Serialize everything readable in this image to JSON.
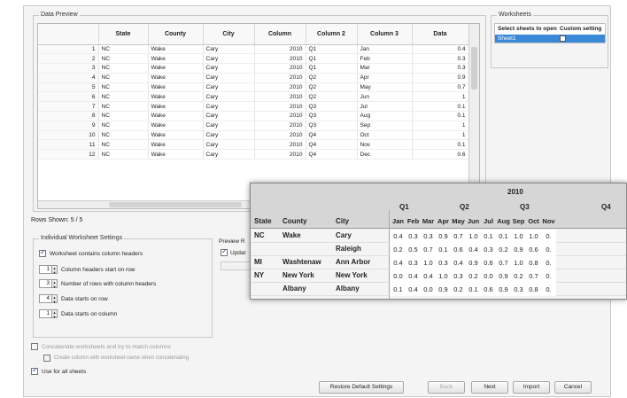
{
  "preview": {
    "title": "Data Preview",
    "columns": [
      "",
      "State",
      "County",
      "City",
      "Column",
      "Column 2",
      "Column 3",
      "Data"
    ],
    "rows": [
      [
        "1",
        "NC",
        "Wake",
        "Cary",
        "2010",
        "Q1",
        "Jan",
        "0.4"
      ],
      [
        "2",
        "NC",
        "Wake",
        "Cary",
        "2010",
        "Q1",
        "Feb",
        "0.3"
      ],
      [
        "3",
        "NC",
        "Wake",
        "Cary",
        "2010",
        "Q1",
        "Mar",
        "0.3"
      ],
      [
        "4",
        "NC",
        "Wake",
        "Cary",
        "2010",
        "Q2",
        "Apr",
        "0.9"
      ],
      [
        "5",
        "NC",
        "Wake",
        "Cary",
        "2010",
        "Q2",
        "May",
        "0.7"
      ],
      [
        "6",
        "NC",
        "Wake",
        "Cary",
        "2010",
        "Q2",
        "Jun",
        "1"
      ],
      [
        "7",
        "NC",
        "Wake",
        "Cary",
        "2010",
        "Q3",
        "Jul",
        "0.1"
      ],
      [
        "8",
        "NC",
        "Wake",
        "Cary",
        "2010",
        "Q3",
        "Aug",
        "0.1"
      ],
      [
        "9",
        "NC",
        "Wake",
        "Cary",
        "2010",
        "Q3",
        "Sep",
        "1"
      ],
      [
        "10",
        "NC",
        "Wake",
        "Cary",
        "2010",
        "Q4",
        "Oct",
        "1"
      ],
      [
        "11",
        "NC",
        "Wake",
        "Cary",
        "2010",
        "Q4",
        "Nov",
        "0.1"
      ],
      [
        "12",
        "NC",
        "Wake",
        "Cary",
        "2010",
        "Q4",
        "Dec",
        "0.6"
      ]
    ]
  },
  "rows_shown": "Rows Shown: 5 / 5",
  "worksheets": {
    "title": "Worksheets",
    "header_select": "Select sheets to open",
    "header_custom": "Custom setting",
    "sheets": [
      {
        "name": "Sheet1",
        "custom": false
      }
    ]
  },
  "settings": {
    "title": "Individual Worksheet Settings",
    "contains_headers": "Worksheet contains column headers",
    "headers_start_row_value": "1",
    "headers_start_row_label": "Column headers start on row",
    "rows_with_headers_value": "3",
    "rows_with_headers_label": "Number of rows with column headers",
    "data_starts_row_value": "4",
    "data_starts_row_label": "Data starts on row",
    "data_starts_col_value": "1",
    "data_starts_col_label": "Data starts on column"
  },
  "preview_options": {
    "title": "Preview R",
    "update_label": "Updat"
  },
  "concat": {
    "label": "Concatenate worksheets and try to match columns",
    "sub_label": "Create column with worksheet name when concatenating"
  },
  "use_all": "Use for all sheets",
  "buttons": {
    "restore": "Restore Default Settings",
    "back": "Back",
    "next": "Next",
    "import": "Import",
    "cancel": "Cancel"
  },
  "pivot": {
    "year": "2010",
    "quarters": [
      "Q1",
      "Q2",
      "Q3",
      "Q4"
    ],
    "row_headers": [
      "State",
      "County",
      "City"
    ],
    "months": [
      "Jan",
      "Feb",
      "Mar",
      "Apr",
      "May",
      "Jun",
      "Jul",
      "Aug",
      "Sep",
      "Oct",
      "Nov"
    ],
    "rows": [
      {
        "state": "NC",
        "county": "Wake",
        "city": "Cary",
        "values": [
          "0.4",
          "0.3",
          "0.3",
          "0.9",
          "0.7",
          "1.0",
          "0.1",
          "0.1",
          "1.0",
          "1.0",
          "0."
        ]
      },
      {
        "state": "",
        "county": "",
        "city": "Raleigh",
        "values": [
          "0.2",
          "0.5",
          "0.7",
          "0.1",
          "0.6",
          "0.4",
          "0.3",
          "0.2",
          "0.9",
          "0.6",
          "0."
        ]
      },
      {
        "state": "MI",
        "county": "Washtenaw",
        "city": "Ann Arbor",
        "values": [
          "0.4",
          "0.3",
          "1.0",
          "0.3",
          "0.4",
          "0.9",
          "0.6",
          "0.7",
          "1.0",
          "0.8",
          "0."
        ]
      },
      {
        "state": "NY",
        "county": "New York",
        "city": "New York",
        "values": [
          "0.0",
          "0.4",
          "0.4",
          "1.0",
          "0.3",
          "0.2",
          "0.0",
          "0.9",
          "0.2",
          "0.7",
          "0."
        ]
      },
      {
        "state": "",
        "county": "Albany",
        "city": "Albany",
        "values": [
          "0.1",
          "0.4",
          "0.0",
          "0.9",
          "0.2",
          "0.1",
          "0.6",
          "0.9",
          "0.3",
          "0.8",
          "0."
        ]
      }
    ]
  }
}
